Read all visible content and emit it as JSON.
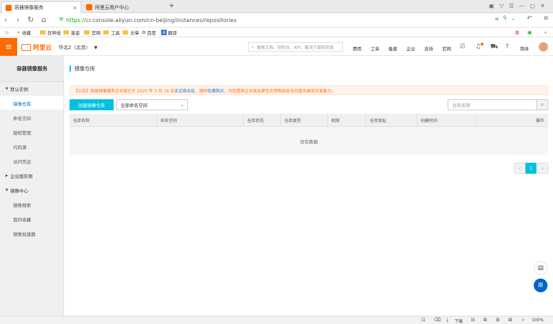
{
  "browser": {
    "tabs": [
      {
        "title": "容器镜像服务",
        "close": "×"
      },
      {
        "title": "阿里云用户中心"
      }
    ],
    "new_tab": "+",
    "url_https": "https://",
    "url_rest": "cr.console.aliyun.com/cn-beijing/instances/repositories",
    "bookmarks": [
      "收藏",
      "狂神说",
      "基金",
      "官网",
      "工具",
      "文章",
      "百度",
      "翻译"
    ],
    "zoom": "100%",
    "status_download": "下载"
  },
  "header": {
    "logo_text": "阿里云",
    "region": "华北2（北京）",
    "search_placeholder": "搜索文档、控制台、API、解决方案和资源",
    "links": [
      "费用",
      "工单",
      "备案",
      "企业",
      "支持",
      "官网"
    ],
    "lang": "简体"
  },
  "sidebar": {
    "title": "容器镜像服务",
    "groups": [
      {
        "label": "默认实例",
        "items": [
          "镜像仓库",
          "命名空间",
          "授权管理",
          "代码源",
          "访问凭证"
        ]
      },
      {
        "label": "企业版实例",
        "items": []
      },
      {
        "label": "镜像中心",
        "items": [
          "镜像搜索",
          "我的收藏",
          "镜像加速器"
        ]
      }
    ]
  },
  "main": {
    "title": "镜像仓库",
    "notice_a": "【公告】容器镜像服务企业版已于 2020 年 3 月 16 日",
    "notice_b": "正式商业化",
    "notice_c": "，限时",
    "notice_d": "优惠购买",
    "notice_e": "，为您提供企业级云原生应用制品安全托管及高效分发能力。",
    "create_button": "创建镜像仓库",
    "namespace_select": "全部命名空间",
    "repo_search_placeholder": "仓库名称",
    "columns": [
      "仓库名称",
      "命名空间",
      "仓库状态",
      "仓库类型",
      "权限",
      "仓库地址",
      "创建时间",
      "操作"
    ],
    "empty_text": "没有数据",
    "page_current": "1"
  }
}
